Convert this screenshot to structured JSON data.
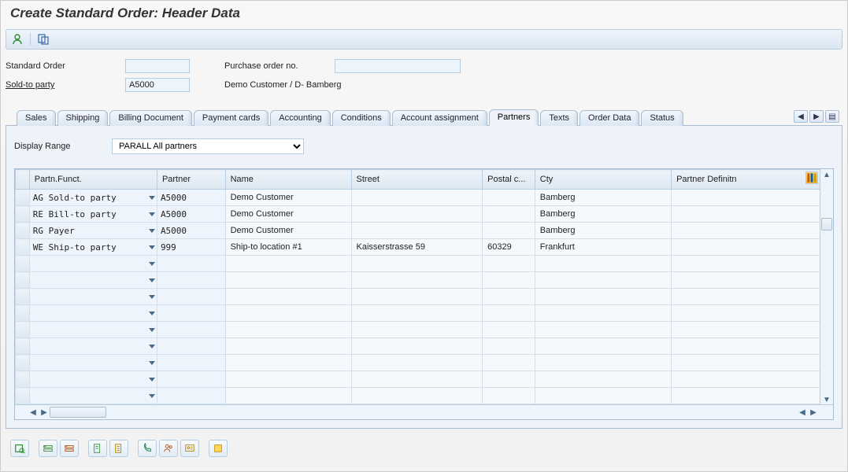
{
  "window": {
    "title": "Create Standard Order: Header Data"
  },
  "header_form": {
    "order_label": "Standard Order",
    "order_value": "",
    "po_label": "Purchase order no.",
    "po_value": "",
    "sold_to_label": "Sold-to party",
    "sold_to_value": "A5000",
    "sold_to_desc": "Demo Customer / D- Bamberg"
  },
  "tabs": [
    {
      "label": "Sales"
    },
    {
      "label": "Shipping"
    },
    {
      "label": "Billing Document"
    },
    {
      "label": "Payment cards"
    },
    {
      "label": "Accounting"
    },
    {
      "label": "Conditions"
    },
    {
      "label": "Account assignment"
    },
    {
      "label": "Partners",
      "active": true
    },
    {
      "label": "Texts"
    },
    {
      "label": "Order Data"
    },
    {
      "label": "Status"
    }
  ],
  "display_range": {
    "label": "Display Range",
    "selected": "PARALL All partners"
  },
  "grid": {
    "columns": [
      "Partn.Funct.",
      "Partner",
      "Name",
      "Street",
      "Postal c...",
      "Cty",
      "Partner Definitn"
    ],
    "rows": [
      {
        "pf": "AG Sold-to party",
        "partner": "A5000",
        "name": "Demo Customer",
        "street": "",
        "postal": "",
        "city": "Bamberg",
        "pdef": ""
      },
      {
        "pf": "RE Bill-to party",
        "partner": "A5000",
        "name": "Demo Customer",
        "street": "",
        "postal": "",
        "city": "Bamberg",
        "pdef": ""
      },
      {
        "pf": "RG Payer",
        "partner": "A5000",
        "name": "Demo Customer",
        "street": "",
        "postal": "",
        "city": "Bamberg",
        "pdef": ""
      },
      {
        "pf": "WE Ship-to party",
        "partner": "999",
        "name": "Ship-to location #1",
        "street": "Kaisserstrasse 59",
        "postal": "60329",
        "city": "Frankfurt",
        "pdef": ""
      },
      {
        "pf": "",
        "partner": "",
        "name": "",
        "street": "",
        "postal": "",
        "city": "",
        "pdef": ""
      },
      {
        "pf": "",
        "partner": "",
        "name": "",
        "street": "",
        "postal": "",
        "city": "",
        "pdef": ""
      },
      {
        "pf": "",
        "partner": "",
        "name": "",
        "street": "",
        "postal": "",
        "city": "",
        "pdef": ""
      },
      {
        "pf": "",
        "partner": "",
        "name": "",
        "street": "",
        "postal": "",
        "city": "",
        "pdef": ""
      },
      {
        "pf": "",
        "partner": "",
        "name": "",
        "street": "",
        "postal": "",
        "city": "",
        "pdef": ""
      },
      {
        "pf": "",
        "partner": "",
        "name": "",
        "street": "",
        "postal": "",
        "city": "",
        "pdef": ""
      },
      {
        "pf": "",
        "partner": "",
        "name": "",
        "street": "",
        "postal": "",
        "city": "",
        "pdef": ""
      },
      {
        "pf": "",
        "partner": "",
        "name": "",
        "street": "",
        "postal": "",
        "city": "",
        "pdef": ""
      },
      {
        "pf": "",
        "partner": "",
        "name": "",
        "street": "",
        "postal": "",
        "city": "",
        "pdef": ""
      }
    ]
  }
}
